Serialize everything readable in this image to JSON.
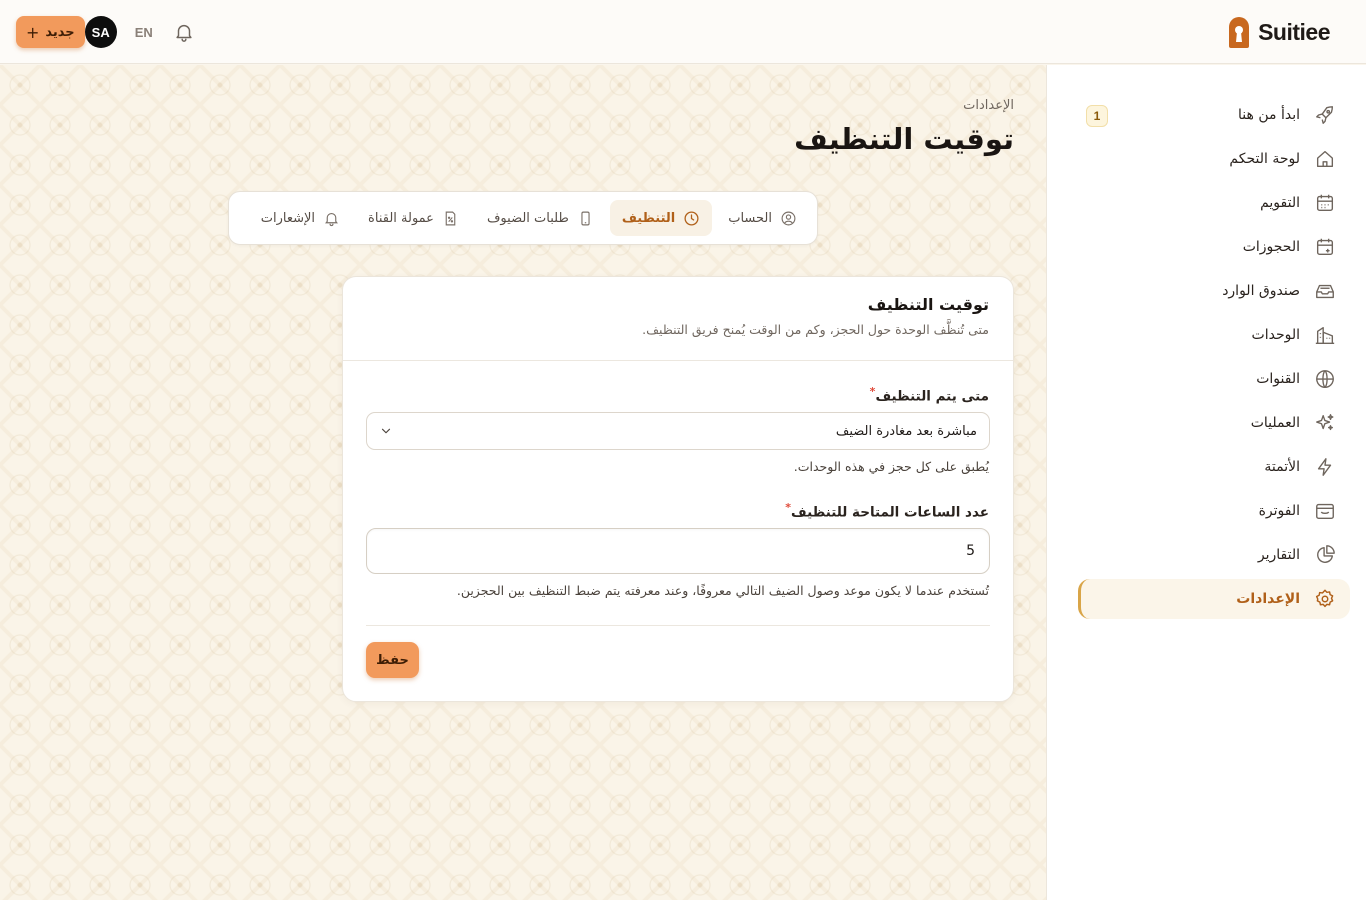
{
  "app": {
    "name": "Suitiee"
  },
  "topbar": {
    "new_button": "جديد",
    "new_plus": "+",
    "avatar": "SA",
    "language": "EN"
  },
  "page": {
    "breadcrumb": "الإعدادات",
    "title": "توقيت التنظيف"
  },
  "tabs": [
    {
      "label": "الحساب",
      "icon": "user-circle-icon"
    },
    {
      "label": "التنظيف",
      "icon": "clock-icon",
      "active": true
    },
    {
      "label": "طلبات الضيوف",
      "icon": "phone-icon"
    },
    {
      "label": "عمولة القناة",
      "icon": "percent-icon"
    },
    {
      "label": "الإشعارات",
      "icon": "bell-icon"
    }
  ],
  "card": {
    "title": "توقيت التنظيف",
    "subtitle": "متى تُنظَّف الوحدة حول الحجز، وكم من الوقت يُمنح فريق التنظيف.",
    "when_label": "متى يتم التنظيف",
    "when_value": "مباشرة بعد مغادرة الضيف",
    "when_hint": "يُطبق على كل حجز في هذه الوحدات.",
    "hours_label": "عدد الساعات المتاحة للتنظيف",
    "hours_value": "5",
    "hours_hint": "تُستخدم عندما لا يكون موعد وصول الضيف التالي معروفًا، وعند معرفته يتم ضبط التنظيف بين الحجزين.",
    "save_button": "حفظ",
    "required_mark": "*"
  },
  "sidebar": {
    "items": [
      {
        "label": "ابدأ من هنا",
        "icon": "rocket-icon",
        "badge": "1"
      },
      {
        "label": "لوحة التحكم",
        "icon": "home-icon"
      },
      {
        "label": "التقويم",
        "icon": "calendar-icon"
      },
      {
        "label": "الحجوزات",
        "icon": "calendar-check-icon"
      },
      {
        "label": "صندوق الوارد",
        "icon": "inbox-icon"
      },
      {
        "label": "الوحدات",
        "icon": "building-icon"
      },
      {
        "label": "القنوات",
        "icon": "globe-icon"
      },
      {
        "label": "العمليات",
        "icon": "sparkles-icon"
      },
      {
        "label": "الأتمتة",
        "icon": "bolt-icon"
      },
      {
        "label": "الفوترة",
        "icon": "billing-icon"
      },
      {
        "label": "التقارير",
        "icon": "pie-chart-icon"
      },
      {
        "label": "الإعدادات",
        "icon": "gear-icon",
        "active": true
      }
    ]
  },
  "colors": {
    "accent": "#f29a5c",
    "active_text": "#b06019",
    "active_bg": "#fbf5e9",
    "active_border": "#d9a548",
    "logo": "#c8681f"
  }
}
